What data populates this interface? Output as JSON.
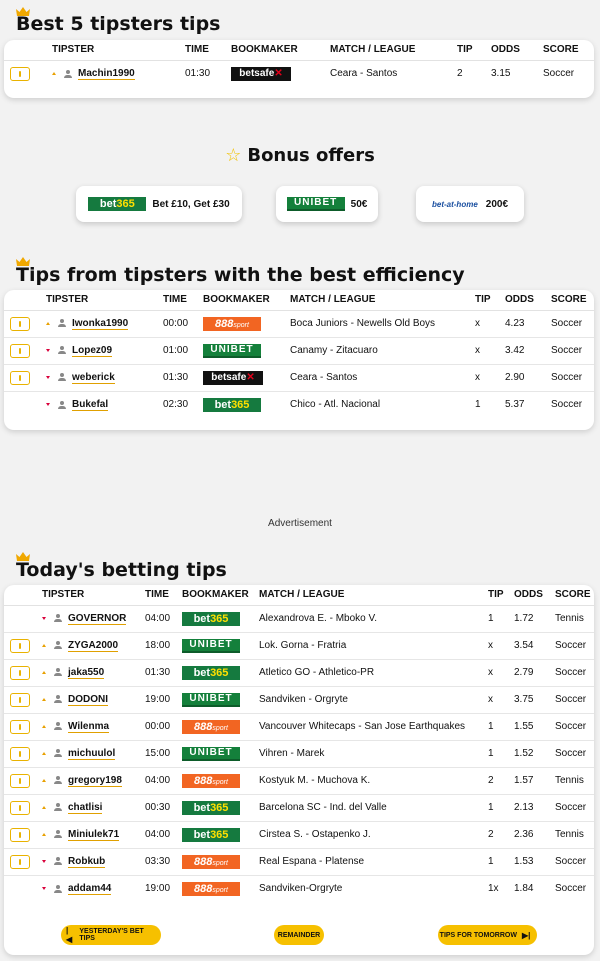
{
  "sections": {
    "best5": "Best 5 tipsters tips",
    "bonus": "Bonus offers",
    "efficiency": "Tips from tipsters with the best efficiency",
    "today": "Today's betting tips"
  },
  "headers": {
    "tipster": "TIPSTER",
    "time": "TIME",
    "bookmaker": "BOOKMAKER",
    "match": "MATCH / LEAGUE",
    "tip": "TIP",
    "odds": "ODDS",
    "score": "SCORE"
  },
  "best5": [
    {
      "tipster": "Machin1990",
      "time": "01:30",
      "match": "Ceara - Santos",
      "tip": "2",
      "odds": "3.15",
      "score": "Soccer"
    }
  ],
  "bonus_offers": [
    {
      "offer": "Bet £10, Get £30"
    },
    {
      "offer": "50€"
    },
    {
      "offer": "200€"
    }
  ],
  "logos": {
    "bet365_a": "bet",
    "bet365_b": "365",
    "unibet": "UNIBET",
    "s888_a": "888",
    "s888_b": "sport",
    "betsafe_a": "betsafe",
    "betsafe_b": "✕",
    "betathome": "bet-at-home"
  },
  "efficiency": [
    {
      "tipster": "Iwonka1990",
      "time": "00:00",
      "match": "Boca Juniors - Newells Old Boys",
      "tip": "x",
      "odds": "4.23",
      "score": "Soccer"
    },
    {
      "tipster": "Lopez09",
      "time": "01:00",
      "match": "Canamy - Zitacuaro",
      "tip": "x",
      "odds": "3.42",
      "score": "Soccer"
    },
    {
      "tipster": "weberick",
      "time": "01:30",
      "match": "Ceara - Santos",
      "tip": "x",
      "odds": "2.90",
      "score": "Soccer"
    },
    {
      "tipster": "Bukefal",
      "time": "02:30",
      "match": "Chico - Atl. Nacional",
      "tip": "1",
      "odds": "5.37",
      "score": "Soccer"
    }
  ],
  "advertisement": "Advertisement",
  "today": [
    {
      "tipster": "GOVERNOR",
      "time": "04:00",
      "match": "Alexandrova E. - Mboko V.",
      "tip": "1",
      "odds": "1.72",
      "score": "Tennis"
    },
    {
      "tipster": "ZYGA2000",
      "time": "18:00",
      "match": "Lok. Gorna - Fratria",
      "tip": "x",
      "odds": "3.54",
      "score": "Soccer"
    },
    {
      "tipster": "jaka550",
      "time": "01:30",
      "match": "Atletico GO - Athletico-PR",
      "tip": "x",
      "odds": "2.79",
      "score": "Soccer"
    },
    {
      "tipster": "DODONI",
      "time": "19:00",
      "match": "Sandviken - Orgryte",
      "tip": "x",
      "odds": "3.75",
      "score": "Soccer"
    },
    {
      "tipster": "Wilenma",
      "time": "00:00",
      "match": "Vancouver Whitecaps - San Jose Earthquakes",
      "tip": "1",
      "odds": "1.55",
      "score": "Soccer"
    },
    {
      "tipster": "michuulol",
      "time": "15:00",
      "match": "Vihren - Marek",
      "tip": "1",
      "odds": "1.52",
      "score": "Soccer"
    },
    {
      "tipster": "gregory198",
      "time": "04:00",
      "match": "Kostyuk M. - Muchova K.",
      "tip": "2",
      "odds": "1.57",
      "score": "Tennis"
    },
    {
      "tipster": "chatlisi",
      "time": "00:30",
      "match": "Barcelona SC - Ind. del Valle",
      "tip": "1",
      "odds": "2.13",
      "score": "Soccer"
    },
    {
      "tipster": "Miniulek71",
      "time": "04:00",
      "match": "Cirstea S. - Ostapenko J.",
      "tip": "2",
      "odds": "2.36",
      "score": "Tennis"
    },
    {
      "tipster": "Robkub",
      "time": "03:30",
      "match": "Real Espana - Platense",
      "tip": "1",
      "odds": "1.53",
      "score": "Soccer"
    },
    {
      "tipster": "addam44",
      "time": "19:00",
      "match": "Sandviken-Orgryte",
      "tip": "1x",
      "odds": "1.84",
      "score": "Soccer"
    }
  ],
  "nav": {
    "yesterday": "YESTERDAY'S BET TIPS",
    "remainder": "REMAINDER",
    "tomorrow": "TIPS FOR TOMORROW"
  },
  "colors": {
    "accent": "#f6c000",
    "bet365": "#157a3f",
    "unibet": "#14803b",
    "s888": "#f26522"
  }
}
